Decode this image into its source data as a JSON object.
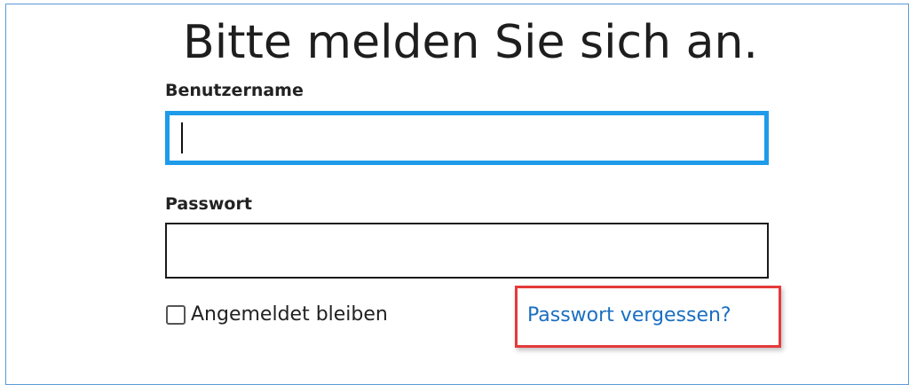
{
  "login": {
    "title": "Bitte melden Sie sich an.",
    "username_label": "Benutzername",
    "username_value": "",
    "password_label": "Passwort",
    "password_value": "",
    "remember_label": "Angemeldet bleiben",
    "remember_checked": false,
    "forgot_link": "Passwort vergessen?"
  },
  "colors": {
    "focus_border": "#1e9be9",
    "link": "#1a6fc1",
    "highlight": "#e53a3a",
    "frame_border": "#5b9bd5"
  }
}
